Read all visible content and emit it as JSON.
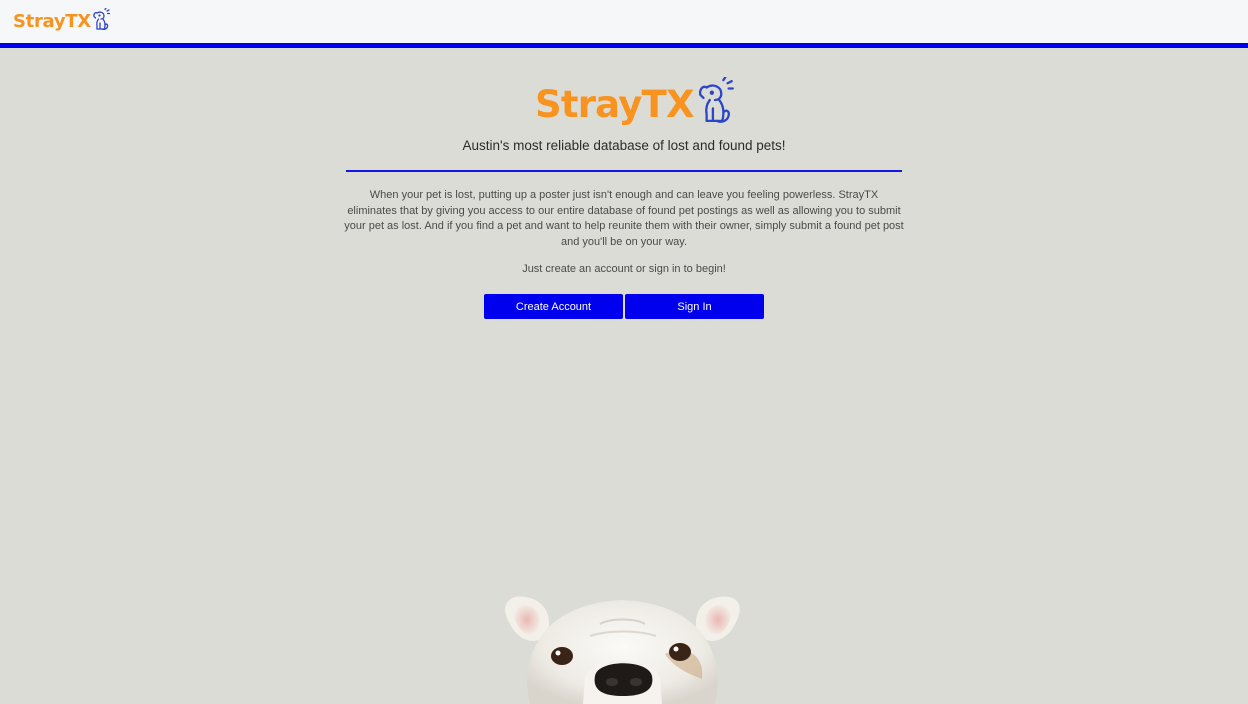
{
  "navbar": {
    "brand": "StrayTX",
    "brand_icon": "dog-icon"
  },
  "hero": {
    "logo_text": "StrayTX",
    "logo_icon": "dog-icon",
    "tagline": "Austin's most reliable database of lost and found pets!",
    "description": "When your pet is lost, putting up a poster just isn't enough and can leave you feeling powerless. StrayTX eliminates that by giving you access to our entire database of found pet postings as well as allowing you to submit your pet as lost. And if you find a pet and want to help reunite them with their owner, simply submit a found pet post and you'll be on your way.",
    "cta_text": "Just create an account or sign in to begin!",
    "create_account_label": "Create Account",
    "sign_in_label": "Sign In"
  },
  "colors": {
    "brand_orange": "#f7931e",
    "accent_blue": "#0000ee",
    "background": "#dcdcd7",
    "navbar_bg": "#f6f7f9"
  }
}
